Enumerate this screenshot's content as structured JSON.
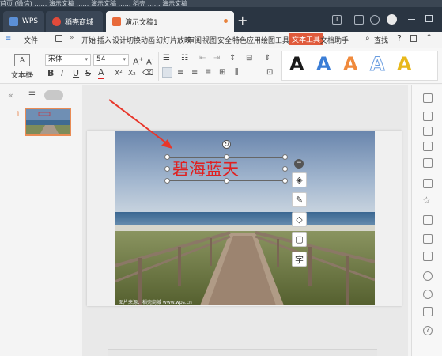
{
  "window": {
    "top_strip_text": "首页 (微信) …… 演示文稿 …… 演示文稿 …… 稻壳 …… 演示文稿",
    "tabs": [
      {
        "label": "WPS"
      },
      {
        "label": "稻壳商城"
      },
      {
        "label": "演示文稿1"
      }
    ],
    "tab_add": "+",
    "badge": "1"
  },
  "menu": {
    "file": "文件",
    "items": [
      "开始",
      "插入",
      "设计",
      "切换",
      "动画",
      "幻灯片放映",
      "审阅",
      "视图",
      "安全",
      "特色应用",
      "绘图工具"
    ],
    "text_tool": "文本工具",
    "doc_helper": "文档助手",
    "search": "查找",
    "help": "?"
  },
  "ribbon": {
    "textbox_label": "文本框",
    "font_name": "宋体",
    "font_size": "54",
    "bold": "B",
    "italic": "I",
    "underline": "U",
    "strike": "S",
    "font_color": "A",
    "superscript": "X²",
    "subscript": "X₂",
    "art_styles": [
      {
        "char": "A",
        "color": "#1a1a1a"
      },
      {
        "char": "A",
        "color": "#3b7ed6"
      },
      {
        "char": "A",
        "color": "#f08a3c"
      },
      {
        "char": "A",
        "color": "#6a9de0"
      },
      {
        "char": "A",
        "color": "#e8b81a"
      }
    ]
  },
  "left_pane": {
    "slide_number": "1"
  },
  "slide": {
    "title_text": "碧海蓝天",
    "title_color": "#e02020",
    "caption": "图片来源：稻壳商城 www.wps.cn"
  },
  "colors": {
    "titlebar": "#2a3542",
    "accent": "#e05a3b",
    "arrow": "#e8362a"
  }
}
